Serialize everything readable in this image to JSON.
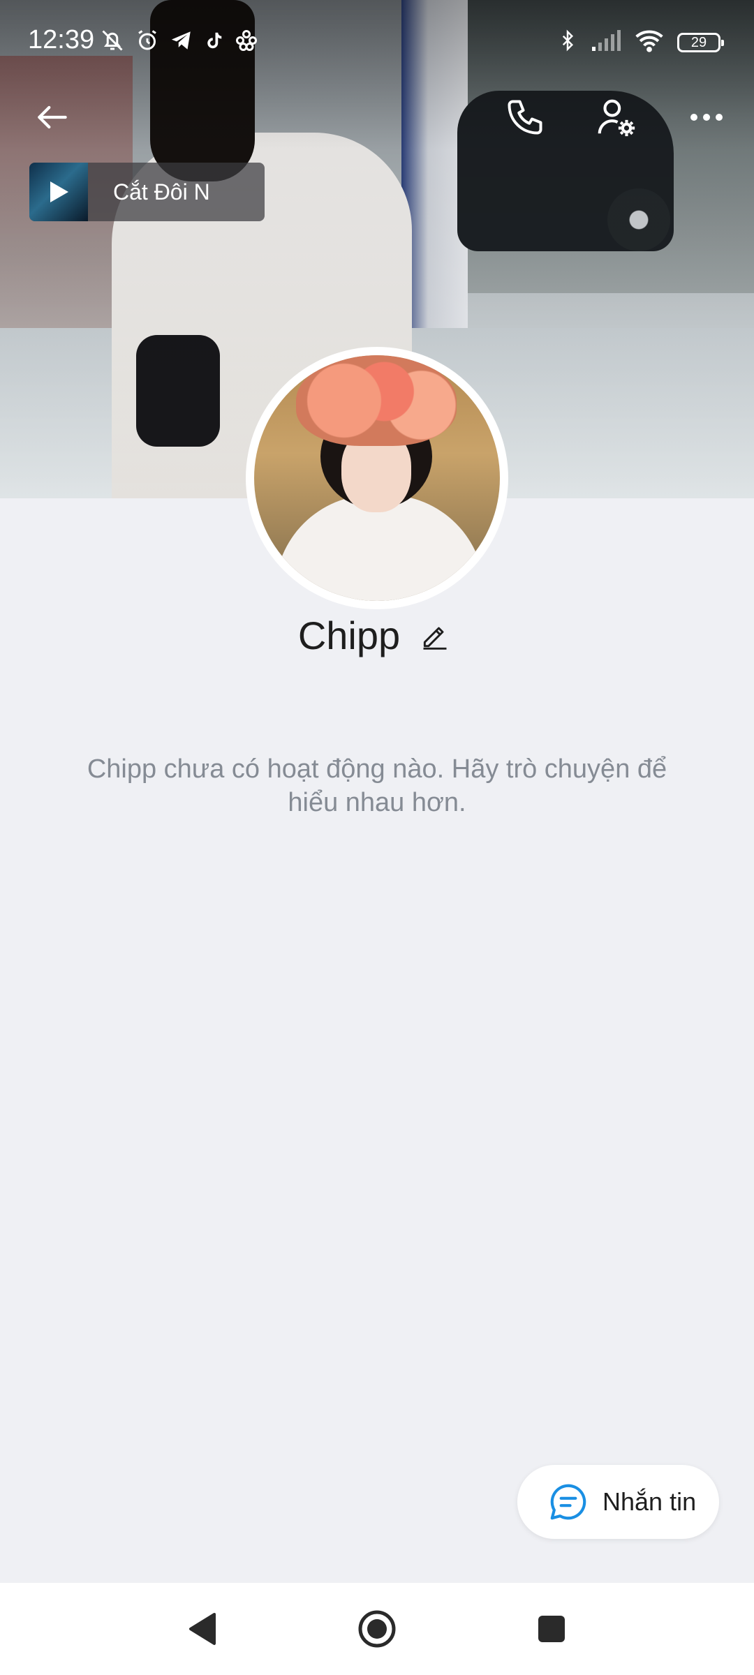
{
  "status_bar": {
    "time": "12:39",
    "left_icons": [
      "notifications-off-icon",
      "alarm-icon",
      "telegram-icon",
      "tiktok-icon",
      "app-icon"
    ],
    "right_icons": [
      "bluetooth-icon",
      "signal-icon",
      "wifi-icon"
    ],
    "battery": "29"
  },
  "header": {
    "icons": [
      "back-arrow-icon",
      "phone-icon",
      "user-settings-icon",
      "more-icon"
    ]
  },
  "music": {
    "title": "Cắt Đôi N"
  },
  "profile": {
    "name": "Chipp",
    "empty_message": "Chipp chưa có hoạt động nào. Hãy trò chuyện để hiểu nhau hơn."
  },
  "actions": {
    "message_label": "Nhắn tin"
  },
  "colors": {
    "background": "#eff0f4",
    "accent": "#1a8fe3",
    "muted_text": "#858b94"
  }
}
